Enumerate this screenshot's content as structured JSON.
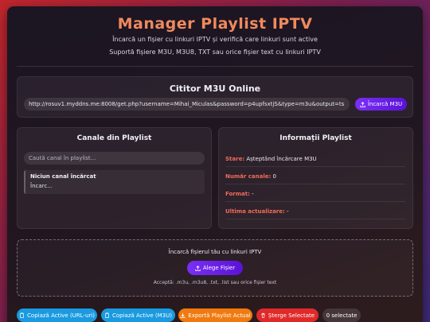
{
  "header": {
    "title": "Manager Playlist IPTV",
    "subtitle1": "Încarcă un fișier cu linkuri IPTV și verifică care linkuri sunt active",
    "subtitle2": "Suportă fișiere M3U, M3U8, TXT sau orice fișier text cu linkuri IPTV"
  },
  "reader": {
    "title": "Cititor M3U Online",
    "url": "http://rosuv1.myddns.me:8008/get.php?username=Mihai_Miculas&password=p4upfsxtjS&type=m3u&output=ts",
    "load_label": "Încarcă M3U"
  },
  "channels": {
    "title": "Canale din Playlist",
    "search_placeholder": "Caută canal în playlist...",
    "empty_title": "Niciun canal încărcat",
    "empty_text": "Încarc..."
  },
  "info": {
    "title": "Informații Playlist",
    "status_label": "Stare:",
    "status_value": "Așteptând încărcare M3U",
    "count_label": "Număr canale:",
    "count_value": "0",
    "format_label": "Format:",
    "format_value": "-",
    "updated_label": "Ultima actualizare:",
    "updated_value": "-"
  },
  "upload": {
    "title": "Încarcă fișierul tău cu linkuri IPTV",
    "choose_label": "Alege Fișier",
    "accept_text": "Acceptă: .m3u, .m3u8, .txt, .list sau orice fișier text"
  },
  "actions": {
    "copy_url_label": "Copiază Active (URL-uri)",
    "copy_m3u_label": "Copiază Active (M3U)",
    "export_label": "Exportă Playlist Actual",
    "delete_label": "Șterge Selectate",
    "selected_label": "0 selectate"
  },
  "colors": {
    "accent_title": "#f08a5d",
    "purple": "#6a1fe8",
    "blue": "#1a9ae0",
    "orange": "#f07a10",
    "red": "#e02a2a",
    "info_key": "#f06b5a"
  }
}
